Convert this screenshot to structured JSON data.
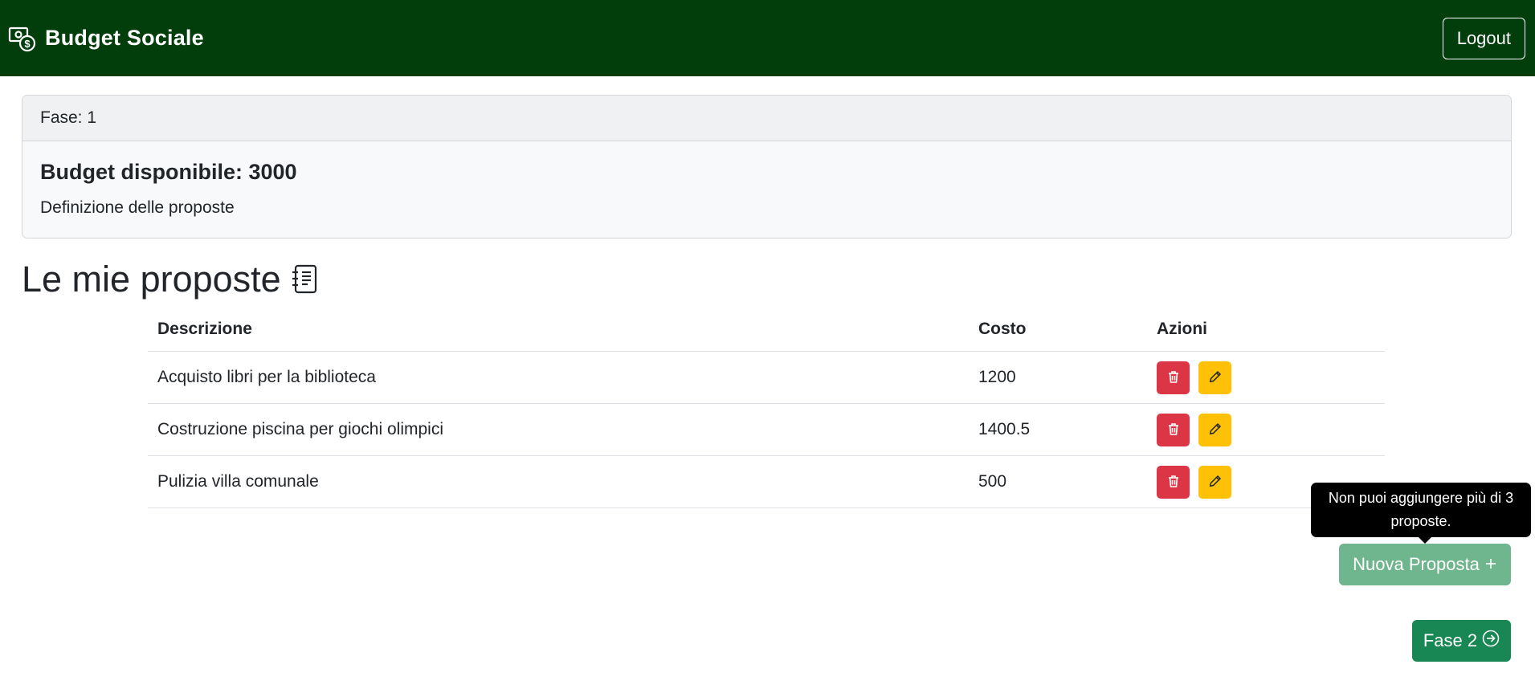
{
  "navbar": {
    "brand_icon": "cash-coin-icon",
    "brand": "Budget Sociale",
    "logout_label": "Logout",
    "background": "#023e0c"
  },
  "phase_card": {
    "header_label": "Fase:",
    "phase": "1",
    "title": "Budget disponibile: 3000",
    "description": "Definizione delle proposte"
  },
  "proposals": {
    "title": "Le mie proposte",
    "title_icon": "journal-text-icon",
    "columns": [
      "Descrizione",
      "Costo",
      "Azioni"
    ],
    "rows": [
      {
        "description": "Acquisto libri per la biblioteca",
        "cost": "1200"
      },
      {
        "description": "Costruzione piscina per giochi olimpici",
        "cost": "1400.5"
      },
      {
        "description": "Pulizia villa comunale",
        "cost": "500"
      }
    ],
    "row_actions": [
      "trash-icon",
      "pencil-icon"
    ]
  },
  "tooltip": {
    "line1": "Non puoi aggiungere più di 3",
    "line2": "proposte."
  },
  "buttons": {
    "new_proposal": "Nuova Proposta",
    "new_proposal_icon": "plus-icon",
    "next_phase": "Fase 2",
    "next_phase_icon": "arrow-right-circle-icon"
  },
  "colors": {
    "danger": "#dc3545",
    "warning": "#ffc107",
    "success": "#198754",
    "success_disabled": "#6fb58d"
  }
}
